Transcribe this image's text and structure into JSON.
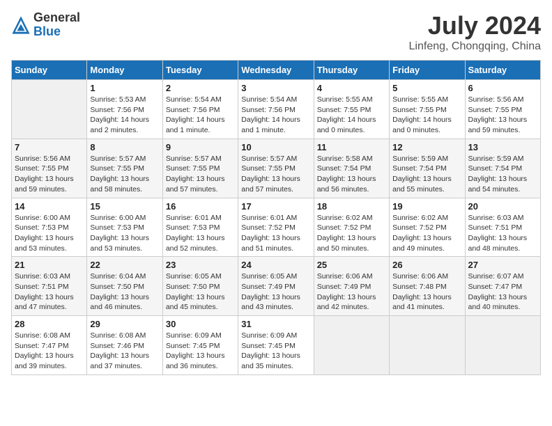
{
  "logo": {
    "general": "General",
    "blue": "Blue"
  },
  "title": "July 2024",
  "location": "Linfeng, Chongqing, China",
  "days_of_week": [
    "Sunday",
    "Monday",
    "Tuesday",
    "Wednesday",
    "Thursday",
    "Friday",
    "Saturday"
  ],
  "weeks": [
    [
      {
        "day": "",
        "info": ""
      },
      {
        "day": "1",
        "info": "Sunrise: 5:53 AM\nSunset: 7:56 PM\nDaylight: 14 hours\nand 2 minutes."
      },
      {
        "day": "2",
        "info": "Sunrise: 5:54 AM\nSunset: 7:56 PM\nDaylight: 14 hours\nand 1 minute."
      },
      {
        "day": "3",
        "info": "Sunrise: 5:54 AM\nSunset: 7:56 PM\nDaylight: 14 hours\nand 1 minute."
      },
      {
        "day": "4",
        "info": "Sunrise: 5:55 AM\nSunset: 7:55 PM\nDaylight: 14 hours\nand 0 minutes."
      },
      {
        "day": "5",
        "info": "Sunrise: 5:55 AM\nSunset: 7:55 PM\nDaylight: 14 hours\nand 0 minutes."
      },
      {
        "day": "6",
        "info": "Sunrise: 5:56 AM\nSunset: 7:55 PM\nDaylight: 13 hours\nand 59 minutes."
      }
    ],
    [
      {
        "day": "7",
        "info": "Sunrise: 5:56 AM\nSunset: 7:55 PM\nDaylight: 13 hours\nand 59 minutes."
      },
      {
        "day": "8",
        "info": "Sunrise: 5:57 AM\nSunset: 7:55 PM\nDaylight: 13 hours\nand 58 minutes."
      },
      {
        "day": "9",
        "info": "Sunrise: 5:57 AM\nSunset: 7:55 PM\nDaylight: 13 hours\nand 57 minutes."
      },
      {
        "day": "10",
        "info": "Sunrise: 5:57 AM\nSunset: 7:55 PM\nDaylight: 13 hours\nand 57 minutes."
      },
      {
        "day": "11",
        "info": "Sunrise: 5:58 AM\nSunset: 7:54 PM\nDaylight: 13 hours\nand 56 minutes."
      },
      {
        "day": "12",
        "info": "Sunrise: 5:59 AM\nSunset: 7:54 PM\nDaylight: 13 hours\nand 55 minutes."
      },
      {
        "day": "13",
        "info": "Sunrise: 5:59 AM\nSunset: 7:54 PM\nDaylight: 13 hours\nand 54 minutes."
      }
    ],
    [
      {
        "day": "14",
        "info": "Sunrise: 6:00 AM\nSunset: 7:53 PM\nDaylight: 13 hours\nand 53 minutes."
      },
      {
        "day": "15",
        "info": "Sunrise: 6:00 AM\nSunset: 7:53 PM\nDaylight: 13 hours\nand 53 minutes."
      },
      {
        "day": "16",
        "info": "Sunrise: 6:01 AM\nSunset: 7:53 PM\nDaylight: 13 hours\nand 52 minutes."
      },
      {
        "day": "17",
        "info": "Sunrise: 6:01 AM\nSunset: 7:52 PM\nDaylight: 13 hours\nand 51 minutes."
      },
      {
        "day": "18",
        "info": "Sunrise: 6:02 AM\nSunset: 7:52 PM\nDaylight: 13 hours\nand 50 minutes."
      },
      {
        "day": "19",
        "info": "Sunrise: 6:02 AM\nSunset: 7:52 PM\nDaylight: 13 hours\nand 49 minutes."
      },
      {
        "day": "20",
        "info": "Sunrise: 6:03 AM\nSunset: 7:51 PM\nDaylight: 13 hours\nand 48 minutes."
      }
    ],
    [
      {
        "day": "21",
        "info": "Sunrise: 6:03 AM\nSunset: 7:51 PM\nDaylight: 13 hours\nand 47 minutes."
      },
      {
        "day": "22",
        "info": "Sunrise: 6:04 AM\nSunset: 7:50 PM\nDaylight: 13 hours\nand 46 minutes."
      },
      {
        "day": "23",
        "info": "Sunrise: 6:05 AM\nSunset: 7:50 PM\nDaylight: 13 hours\nand 45 minutes."
      },
      {
        "day": "24",
        "info": "Sunrise: 6:05 AM\nSunset: 7:49 PM\nDaylight: 13 hours\nand 43 minutes."
      },
      {
        "day": "25",
        "info": "Sunrise: 6:06 AM\nSunset: 7:49 PM\nDaylight: 13 hours\nand 42 minutes."
      },
      {
        "day": "26",
        "info": "Sunrise: 6:06 AM\nSunset: 7:48 PM\nDaylight: 13 hours\nand 41 minutes."
      },
      {
        "day": "27",
        "info": "Sunrise: 6:07 AM\nSunset: 7:47 PM\nDaylight: 13 hours\nand 40 minutes."
      }
    ],
    [
      {
        "day": "28",
        "info": "Sunrise: 6:08 AM\nSunset: 7:47 PM\nDaylight: 13 hours\nand 39 minutes."
      },
      {
        "day": "29",
        "info": "Sunrise: 6:08 AM\nSunset: 7:46 PM\nDaylight: 13 hours\nand 37 minutes."
      },
      {
        "day": "30",
        "info": "Sunrise: 6:09 AM\nSunset: 7:45 PM\nDaylight: 13 hours\nand 36 minutes."
      },
      {
        "day": "31",
        "info": "Sunrise: 6:09 AM\nSunset: 7:45 PM\nDaylight: 13 hours\nand 35 minutes."
      },
      {
        "day": "",
        "info": ""
      },
      {
        "day": "",
        "info": ""
      },
      {
        "day": "",
        "info": ""
      }
    ]
  ]
}
